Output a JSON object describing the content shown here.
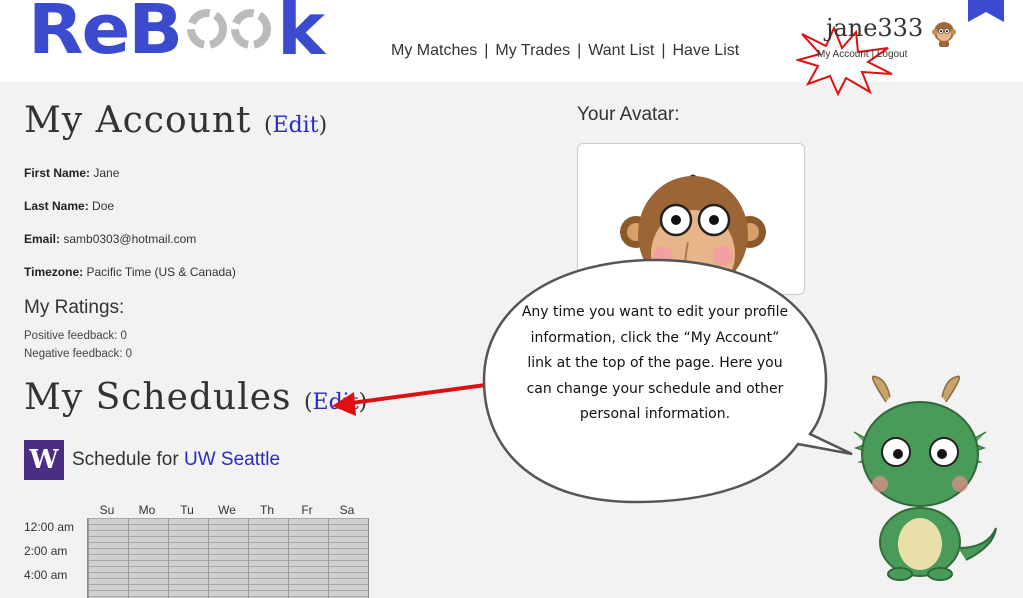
{
  "header": {
    "logo_text": "ReBook",
    "logo_part1": "ReB",
    "logo_part2": "k",
    "nav": [
      "My Matches",
      "My Trades",
      "Want List",
      "Have List"
    ],
    "username": "jane333",
    "account_link": "My Account",
    "logout_link": "Logout"
  },
  "account": {
    "title": "My Account",
    "edit_label": "Edit",
    "fields": [
      {
        "label": "First Name:",
        "value": "Jane"
      },
      {
        "label": "Last Name:",
        "value": "Doe"
      },
      {
        "label": "Email:",
        "value": "samb0303@hotmail.com"
      },
      {
        "label": "Timezone:",
        "value": "Pacific Time (US & Canada)"
      }
    ]
  },
  "ratings": {
    "title": "My Ratings:",
    "positive": "Positive feedback: 0",
    "negative": "Negative feedback: 0"
  },
  "schedules": {
    "title": "My Schedules",
    "edit_label": "Edit",
    "school_logo": "W",
    "school_prefix": "Schedule for",
    "school_name": "UW Seattle",
    "days": [
      "Su",
      "Mo",
      "Tu",
      "We",
      "Th",
      "Fr",
      "Sa"
    ],
    "times": [
      "12:00 am",
      "2:00 am",
      "4:00 am"
    ]
  },
  "avatar": {
    "label": "Your Avatar:"
  },
  "tutorial": {
    "bubble_text": "Any time you want to edit your profile information, click the “My Account” link at the top of the page. Here you can change your schedule and other personal information."
  },
  "colors": {
    "brand_blue": "#3a4bcf",
    "link_blue": "#2a2ac0",
    "uw_purple": "#4b2e83",
    "highlight_red": "#e01010"
  }
}
